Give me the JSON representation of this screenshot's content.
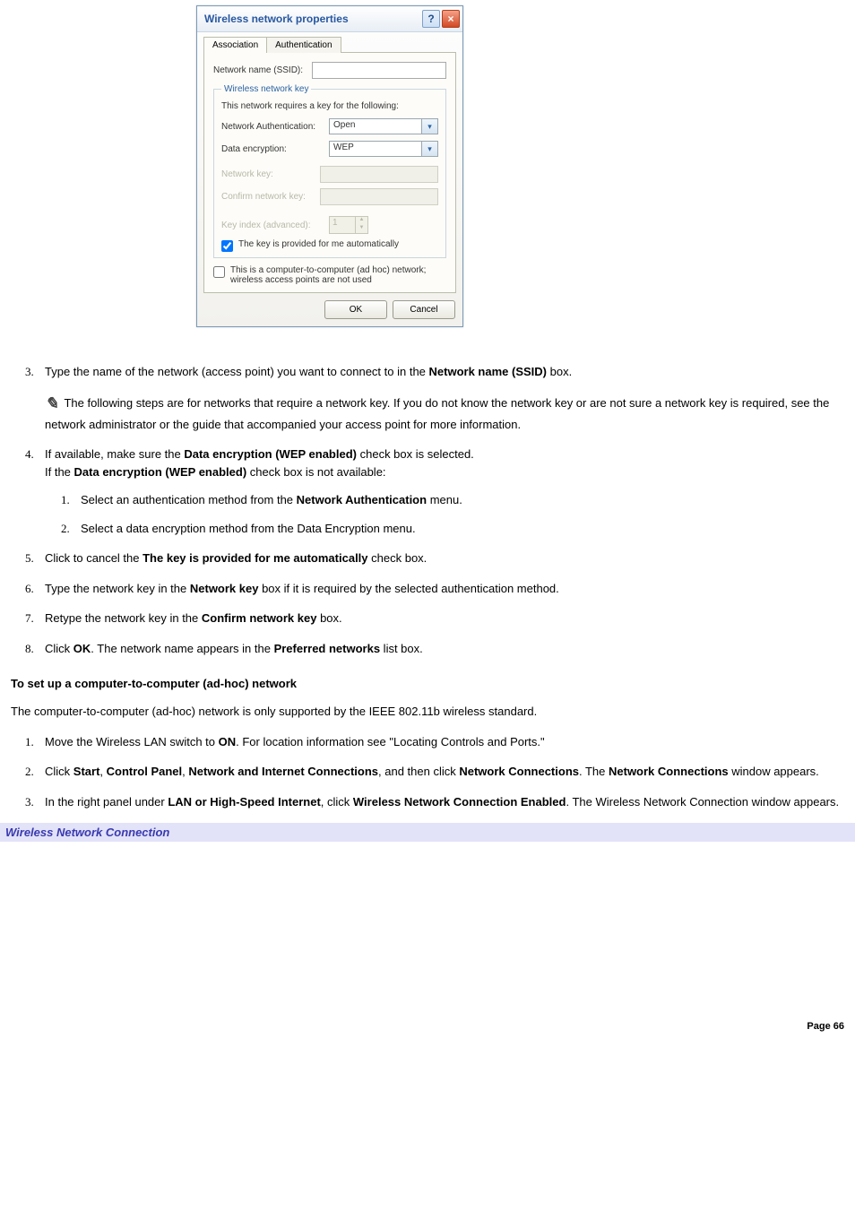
{
  "dialog": {
    "title": "Wireless network properties",
    "tabs": {
      "association": "Association",
      "authentication": "Authentication"
    },
    "ssid_label": "Network name (SSID):",
    "fieldset_legend": "Wireless network key",
    "requires_text": "This network requires a key for the following:",
    "net_auth_label": "Network Authentication:",
    "net_auth_value": "Open",
    "data_enc_label": "Data encryption:",
    "data_enc_value": "WEP",
    "network_key_label": "Network key:",
    "confirm_key_label": "Confirm network key:",
    "key_index_label": "Key index (advanced):",
    "key_index_value": "1",
    "auto_key_label": "The key is provided for me automatically",
    "adhoc_label": "This is a computer-to-computer (ad hoc) network; wireless access points are not used",
    "ok": "OK",
    "cancel": "Cancel"
  },
  "steps": {
    "s3_a": "Type the name of the network (access point) you want to connect to in the ",
    "s3_b": "Network name (SSID)",
    "s3_c": " box.",
    "note": "The following steps are for networks that require a network key. If you do not know the network key or are not sure a network key is required, see the network administrator or the guide that accompanied your access point for more information.",
    "s4_a": "If available, make sure the ",
    "s4_b": "Data encryption (WEP enabled)",
    "s4_c": " check box is selected.",
    "s4_d": "If the ",
    "s4_e": "Data encryption (WEP enabled)",
    "s4_f": " check box is not available:",
    "s4_1a": "Select an authentication method from the ",
    "s4_1b": "Network Authentication",
    "s4_1c": " menu.",
    "s4_2": "Select a data encryption method from the Data Encryption menu.",
    "s5_a": "Click to cancel the ",
    "s5_b": "The key is provided for me automatically",
    "s5_c": " check box.",
    "s6_a": "Type the network key in the ",
    "s6_b": "Network key",
    "s6_c": " box if it is required by the selected authentication method.",
    "s7_a": "Retype the network key in the ",
    "s7_b": "Confirm network key",
    "s7_c": " box.",
    "s8_a": "Click ",
    "s8_b": "OK",
    "s8_c": ". The network name appears in the ",
    "s8_d": "Preferred networks",
    "s8_e": " list box."
  },
  "subheading": "To set up a computer-to-computer (ad-hoc) network",
  "adhoc_intro": "The computer-to-computer (ad-hoc) network is only supported by the IEEE 802.11b wireless standard.",
  "adhoc": {
    "a1_a": "Move the Wireless LAN switch to ",
    "a1_b": "ON",
    "a1_c": ". For location information see \"Locating Controls and Ports.\"",
    "a2_a": "Click ",
    "a2_b": "Start",
    "a2_c": ", ",
    "a2_d": "Control Panel",
    "a2_e": ", ",
    "a2_f": "Network and Internet Connections",
    "a2_g": ", and then click ",
    "a2_h": "Network Connections",
    "a2_i": ". The ",
    "a2_j": "Network Connections",
    "a2_k": " window appears.",
    "a3_a": "In the right panel under ",
    "a3_b": "LAN or High-Speed Internet",
    "a3_c": ", click ",
    "a3_d": "Wireless Network Connection Enabled",
    "a3_e": ". The Wireless Network Connection window appears."
  },
  "banner": "Wireless Network Connection",
  "page": "Page 66"
}
